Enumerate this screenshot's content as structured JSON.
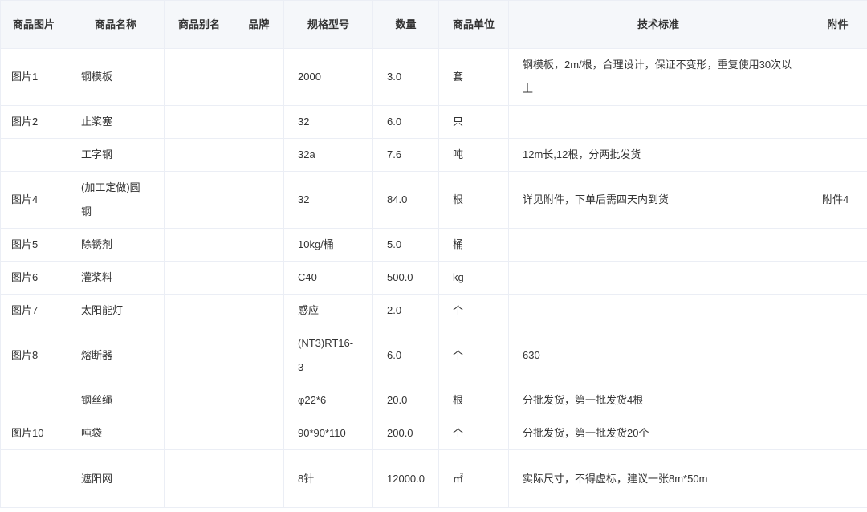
{
  "table": {
    "headers": {
      "image": "商品图片",
      "name": "商品名称",
      "alias": "商品别名",
      "brand": "品牌",
      "spec": "规格型号",
      "qty": "数量",
      "unit": "商品单位",
      "standard": "技术标准",
      "attachment": "附件"
    },
    "rows": [
      {
        "image": "图片1",
        "name": "钢模板",
        "alias": "",
        "brand": "",
        "spec": "2000",
        "qty": "3.0",
        "unit": "套",
        "standard": "钢模板，2m/根，合理设计，保证不变形，重复使用30次以上",
        "attachment": ""
      },
      {
        "image": "图片2",
        "name": "止浆塞",
        "alias": "",
        "brand": "",
        "spec": "32",
        "qty": "6.0",
        "unit": "只",
        "standard": "",
        "attachment": ""
      },
      {
        "image": "",
        "name": "工字钢",
        "alias": "",
        "brand": "",
        "spec": "32a",
        "qty": "7.6",
        "unit": "吨",
        "standard": "12m长,12根，分两批发货",
        "attachment": ""
      },
      {
        "image": "图片4",
        "name": "(加工定做)圆钢",
        "alias": "",
        "brand": "",
        "spec": "32",
        "qty": "84.0",
        "unit": "根",
        "standard": "详见附件，下单后需四天内到货",
        "attachment": "附件4"
      },
      {
        "image": "图片5",
        "name": "除锈剂",
        "alias": "",
        "brand": "",
        "spec": "10kg/桶",
        "qty": "5.0",
        "unit": "桶",
        "standard": "",
        "attachment": ""
      },
      {
        "image": "图片6",
        "name": "灌浆料",
        "alias": "",
        "brand": "",
        "spec": "C40",
        "qty": "500.0",
        "unit": "kg",
        "standard": "",
        "attachment": ""
      },
      {
        "image": "图片7",
        "name": "太阳能灯",
        "alias": "",
        "brand": "",
        "spec": "感应",
        "qty": "2.0",
        "unit": "个",
        "standard": "",
        "attachment": ""
      },
      {
        "image": "图片8",
        "name": "熔断器",
        "alias": "",
        "brand": "",
        "spec": "(NT3)RT16-3",
        "qty": "6.0",
        "unit": "个",
        "standard": "630",
        "attachment": ""
      },
      {
        "image": "",
        "name": "钢丝绳",
        "alias": "",
        "brand": "",
        "spec": "φ22*6",
        "qty": "20.0",
        "unit": "根",
        "standard": "分批发货，第一批发货4根",
        "attachment": ""
      },
      {
        "image": "图片10",
        "name": "吨袋",
        "alias": "",
        "brand": "",
        "spec": "90*90*110",
        "qty": "200.0",
        "unit": "个",
        "standard": "分批发货，第一批发货20个",
        "attachment": ""
      },
      {
        "image": "",
        "name": "遮阳网",
        "alias": "",
        "brand": "",
        "spec": "8针",
        "qty": "12000.0",
        "unit": "㎡",
        "standard": "实际尺寸，不得虚标，建议一张8m*50m",
        "attachment": ""
      }
    ]
  }
}
